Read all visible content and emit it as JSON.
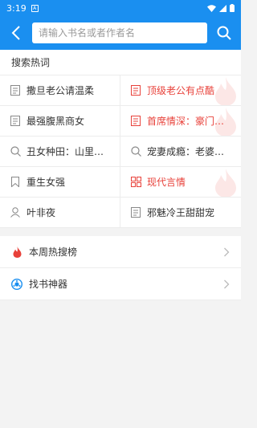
{
  "status": {
    "time": "3:19",
    "notif": "A"
  },
  "search": {
    "placeholder": "请输入书名或者作者名"
  },
  "hot": {
    "title": "搜索热词",
    "items": [
      {
        "label": "撒旦老公请温柔",
        "icon": "book-icon",
        "hot": false
      },
      {
        "label": "顶级老公有点酷",
        "icon": "book-icon",
        "hot": true
      },
      {
        "label": "最强腹黑商女",
        "icon": "book-icon",
        "hot": false
      },
      {
        "label": "首席情深：豪门第...",
        "icon": "book-icon",
        "hot": true
      },
      {
        "label": "丑女种田：山里汉...",
        "icon": "search-icon",
        "hot": false
      },
      {
        "label": "宠妻成瘾：老婆，...",
        "icon": "search-icon",
        "hot": false
      },
      {
        "label": "重生女强",
        "icon": "bookmark-icon",
        "hot": false
      },
      {
        "label": "现代言情",
        "icon": "category-icon",
        "hot": true
      },
      {
        "label": "叶非夜",
        "icon": "user-icon",
        "hot": false
      },
      {
        "label": "邪魅冷王甜甜宠",
        "icon": "book-icon",
        "hot": false
      }
    ]
  },
  "menu": {
    "weekly": "本周热搜榜",
    "finder": "找书神器"
  },
  "colors": {
    "primary": "#1a8ff0",
    "hot": "#e8413a"
  }
}
